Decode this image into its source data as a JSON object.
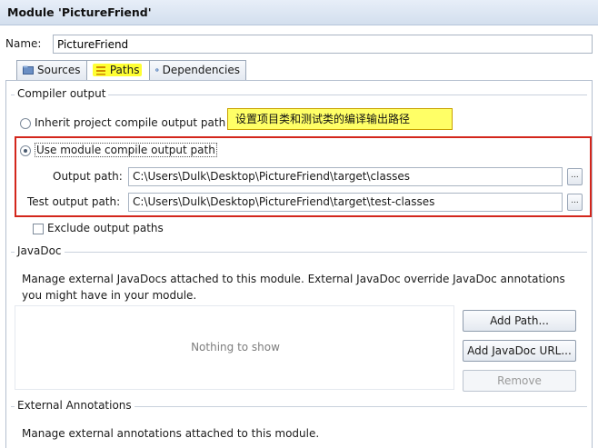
{
  "window": {
    "title": "Module 'PictureFriend'"
  },
  "name_row": {
    "label": "Name:",
    "value": "PictureFriend"
  },
  "tabs": [
    {
      "label": "Sources",
      "icon": "folder-icon",
      "active": false
    },
    {
      "label": "Paths",
      "icon": "paths-icon",
      "active": true,
      "highlight": "#ffff33"
    },
    {
      "label": "Dependencies",
      "icon": "dependencies-icon",
      "active": false
    }
  ],
  "compiler_output": {
    "section_title": "Compiler output",
    "inherit_label": "Inherit project compile output path",
    "inherit_selected": false,
    "use_module_label": "Use module compile output path",
    "use_module_selected": true,
    "output_path_label": "Output path:",
    "output_path_value": "C:\\Users\\Dulk\\Desktop\\PictureFriend\\target\\classes",
    "test_output_label": "Test output path:",
    "test_output_value": "C:\\Users\\Dulk\\Desktop\\PictureFriend\\target\\test-classes",
    "browse_label": "...",
    "exclude_label": "Exclude output paths",
    "exclude_checked": false
  },
  "annotation": {
    "text": "设置项目类和测试类的编译输出路径",
    "color": "#ffff66",
    "box_color": "#d3261c"
  },
  "javadoc": {
    "section_title": "JavaDoc",
    "description": "Manage external JavaDocs attached to this module. External JavaDoc override JavaDoc annotations you might have in your module.",
    "empty_text": "Nothing to show",
    "add_path_label": "Add Path...",
    "add_url_label": "Add JavaDoc URL...",
    "remove_label": "Remove"
  },
  "external_annotations": {
    "section_title": "External Annotations",
    "description": "Manage external annotations attached to this module."
  }
}
